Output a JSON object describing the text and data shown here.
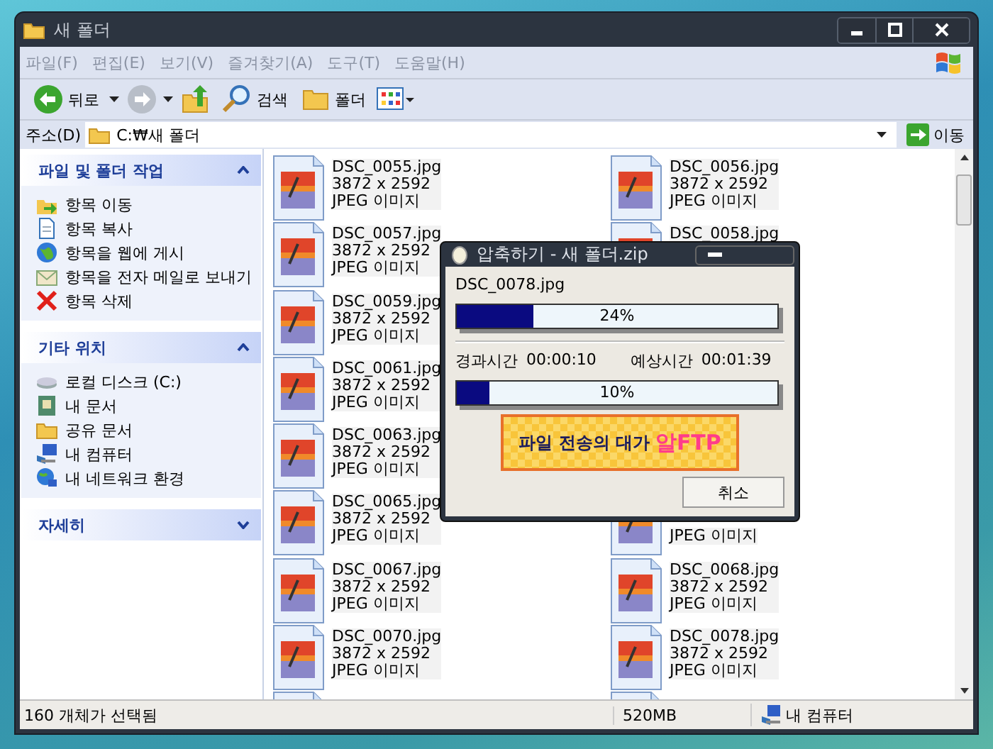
{
  "window": {
    "title": "새 폴더"
  },
  "menu": [
    "파일(F)",
    "편집(E)",
    "보기(V)",
    "즐겨찾기(A)",
    "도구(T)",
    "도움말(H)"
  ],
  "toolbar": {
    "back": "뒤로",
    "search": "검색",
    "folders": "폴더"
  },
  "address": {
    "label": "주소(D)",
    "value": "C:₩새 폴더",
    "go": "이동"
  },
  "sidebar": [
    {
      "title": "파일 및 폴더 작업",
      "expanded": true,
      "items": [
        {
          "label": "항목 이동",
          "kind": "move"
        },
        {
          "label": "항목 복사",
          "kind": "copy"
        },
        {
          "label": "항목을 웹에 게시",
          "kind": "web"
        },
        {
          "label": "항목을 전자 메일로 보내기",
          "kind": "mail"
        },
        {
          "label": "항목 삭제",
          "kind": "delete"
        }
      ]
    },
    {
      "title": "기타 위치",
      "expanded": true,
      "items": [
        {
          "label": "로컬 디스크 (C:)",
          "kind": "disk"
        },
        {
          "label": "내 문서",
          "kind": "documents"
        },
        {
          "label": "공유 문서",
          "kind": "folder"
        },
        {
          "label": "내 컴퓨터",
          "kind": "computer"
        },
        {
          "label": "내 네트워크 환경",
          "kind": "network"
        }
      ]
    },
    {
      "title": "자세히",
      "expanded": false
    }
  ],
  "files": [
    {
      "left": {
        "name": "DSC_0055.jpg",
        "size": "3872 x 2592",
        "type": "JPEG 이미지"
      },
      "right": {
        "name": "DSC_0056.jpg",
        "size": "3872 x 2592",
        "type": "JPEG 이미지"
      }
    },
    {
      "left": {
        "name": "DSC_0057.jpg",
        "size": "3872 x 2592",
        "type": "JPEG 이미지"
      },
      "right": {
        "name": "DSC_0058.jpg"
      }
    },
    {
      "left": {
        "name": "DSC_0059.jpg",
        "size": "3872 x 2592",
        "type": "JPEG 이미지"
      }
    },
    {
      "left": {
        "name": "DSC_0061.jpg",
        "size": "3872 x 2592",
        "type": "JPEG 이미지"
      }
    },
    {
      "left": {
        "name": "DSC_0063.jpg",
        "size": "3872 x 2592",
        "type": "JPEG 이미지"
      }
    },
    {
      "left": {
        "name": "DSC_0065.jpg",
        "size": "3872 x 2592",
        "type": "JPEG 이미지"
      },
      "right": {
        "type": "JPEG 이미지"
      }
    },
    {
      "left": {
        "name": "DSC_0067.jpg",
        "size": "3872 x 2592",
        "type": "JPEG 이미지"
      },
      "right": {
        "name": "DSC_0068.jpg",
        "size": "3872 x 2592",
        "type": "JPEG 이미지"
      }
    },
    {
      "left": {
        "name": "DSC_0070.jpg",
        "size": "3872 x 2592",
        "type": "JPEG 이미지"
      },
      "right": {
        "name": "DSC_0078.jpg",
        "size": "3872 x 2592",
        "type": "JPEG 이미지"
      }
    }
  ],
  "dialog": {
    "title": "압축하기 - 새 폴더.zip",
    "file": "DSC_0078.jpg",
    "file_progress": {
      "level": 0.24,
      "reading": "24%"
    },
    "elapsed_label": "경과시간",
    "elapsed": "00:00:10",
    "remaining_label": "예상시간",
    "remaining": "00:01:39",
    "total_progress": {
      "level": 0.1,
      "reading": "10%"
    },
    "banner": {
      "slogan": "파일 전송의 대가",
      "brand": "알FTP"
    },
    "cancel": "취소"
  },
  "status_bar": {
    "message": "160 개체가 선택됨",
    "size": "520MB",
    "zone": "내 컴퓨터"
  }
}
